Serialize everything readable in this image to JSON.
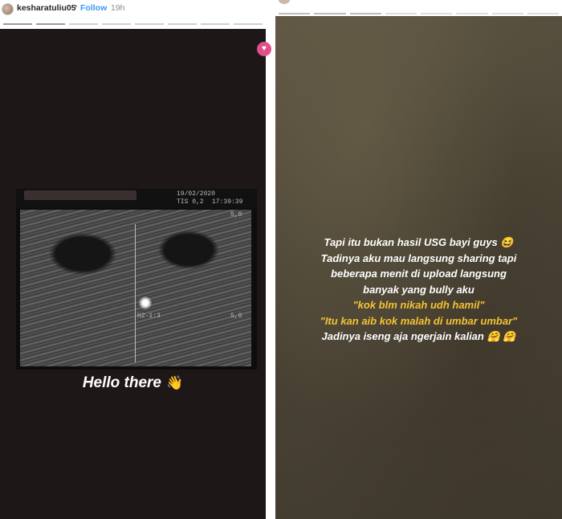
{
  "left_story": {
    "header": {
      "username": "kesharatuliu05",
      "separator": "•",
      "follow_label": "Follow",
      "age": "19h"
    },
    "ultrasound": {
      "top_left_text": "TIS 0,2",
      "date_text": "19/02/2020",
      "time_text": "17:39:39",
      "scale_top": "5,0",
      "scale_bottom": "5,0",
      "probe_label": "H2-1:3"
    },
    "sticker_text": "Hello there",
    "wave_icon": "👋"
  },
  "right_story": {
    "caption_lines": [
      {
        "text": "Tapi itu bukan hasil USG bayi guys 😆",
        "style": "white"
      },
      {
        "text": "Tadinya aku mau langsung sharing tapi",
        "style": "white"
      },
      {
        "text": "beberapa menit di upload langsung",
        "style": "white"
      },
      {
        "text": "banyak yang bully aku",
        "style": "white"
      },
      {
        "text": "\"kok blm nikah udh hamil\"",
        "style": "yellow"
      },
      {
        "text": "\"Itu kan aib kok malah di umbar umbar\"",
        "style": "yellow"
      },
      {
        "text": "Jadinya iseng aja ngerjain kalian 🤗 🤗",
        "style": "white"
      }
    ]
  },
  "colors": {
    "left_background": "#1e1717",
    "caption_white": "#ffffff",
    "caption_yellow": "#f5c332",
    "follow_blue": "#3897f0"
  }
}
